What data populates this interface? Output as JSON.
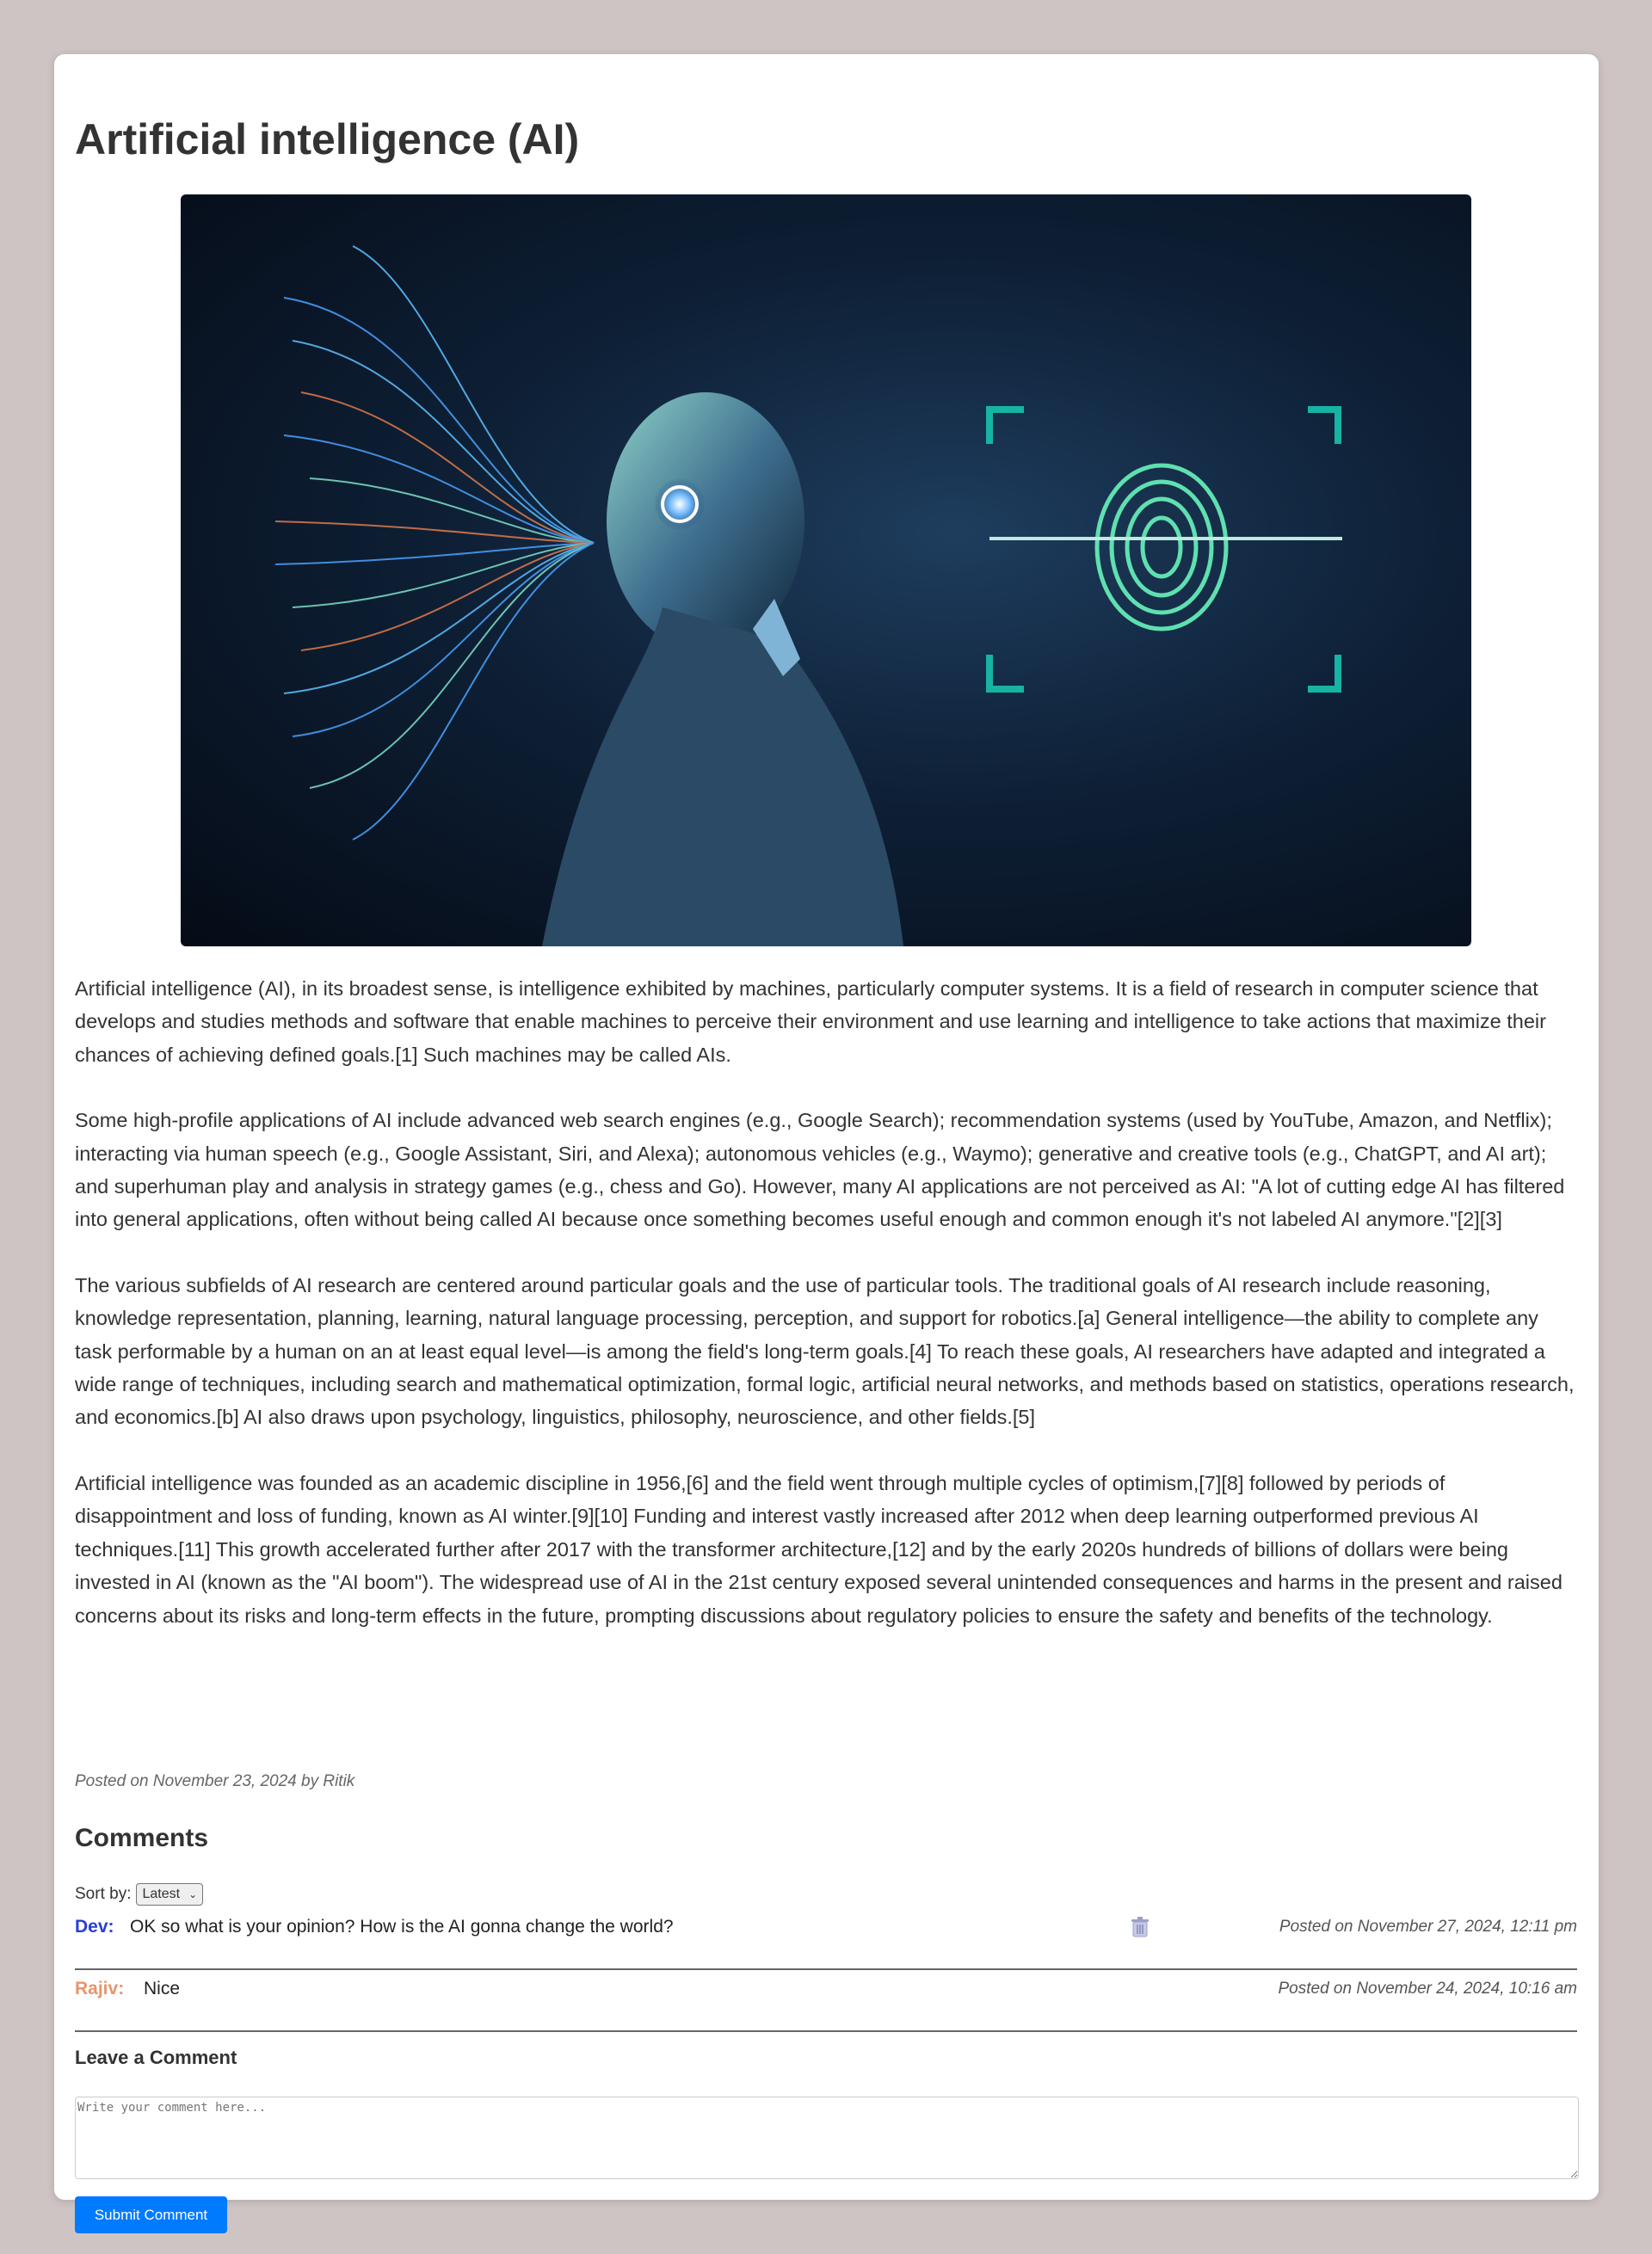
{
  "article": {
    "title": "Artificial intelligence (AI)",
    "paragraphs": [
      "Artificial intelligence (AI), in its broadest sense, is intelligence exhibited by machines, particularly computer systems. It is a field of research in computer science that develops and studies methods and software that enable machines to perceive their environment and use learning and intelligence to take actions that maximize their chances of achieving defined goals.[1] Such machines may be called AIs.",
      "Some high-profile applications of AI include advanced web search engines (e.g., Google Search); recommendation systems (used by YouTube, Amazon, and Netflix); interacting via human speech (e.g., Google Assistant, Siri, and Alexa); autonomous vehicles (e.g., Waymo); generative and creative tools (e.g., ChatGPT, and AI art); and superhuman play and analysis in strategy games (e.g., chess and Go). However, many AI applications are not perceived as AI: \"A lot of cutting edge AI has filtered into general applications, often without being called AI because once something becomes useful enough and common enough it's not labeled AI anymore.\"[2][3]",
      "The various subfields of AI research are centered around particular goals and the use of particular tools. The traditional goals of AI research include reasoning, knowledge representation, planning, learning, natural language processing, perception, and support for robotics.[a] General intelligence—the ability to complete any task performable by a human on an at least equal level—is among the field's long-term goals.[4] To reach these goals, AI researchers have adapted and integrated a wide range of techniques, including search and mathematical optimization, formal logic, artificial neural networks, and methods based on statistics, operations research, and economics.[b] AI also draws upon psychology, linguistics, philosophy, neuroscience, and other fields.[5]",
      "Artificial intelligence was founded as an academic discipline in 1956,[6] and the field went through multiple cycles of optimism,[7][8] followed by periods of disappointment and loss of funding, known as AI winter.[9][10] Funding and interest vastly increased after 2012 when deep learning outperformed previous AI techniques.[11] This growth accelerated further after 2017 with the transformer architecture,[12] and by the early 2020s hundreds of billions of dollars were being invested in AI (known as the \"AI boom\"). The widespread use of AI in the 21st century exposed several unintended consequences and harms in the present and raised concerns about its risks and long-term effects in the future, prompting discussions about regulatory policies to ensure the safety and benefits of the technology."
    ],
    "meta": "Posted on November 23, 2024 by Ritik",
    "hero_image": "ai-robot-fingerprint-image"
  },
  "comments_section": {
    "heading": "Comments",
    "sort_label": "Sort by:",
    "sort_selected": "Latest",
    "items": [
      {
        "author": "Dev:",
        "author_color": "#2b3fd6",
        "text": "OK so what is your opinion? How is the AI gonna change the world?",
        "date": "Posted on November 27, 2024, 12:11 pm",
        "has_delete": true
      },
      {
        "author": "Rajiv:",
        "author_color": "#e8956a",
        "text": "Nice",
        "date": "Posted on November 24, 2024, 10:16 am",
        "has_delete": false
      }
    ]
  },
  "comment_form": {
    "heading": "Leave a Comment",
    "placeholder": "Write your comment here...",
    "value": "",
    "submit_label": "Submit Comment",
    "submit_color": "#007bff"
  }
}
